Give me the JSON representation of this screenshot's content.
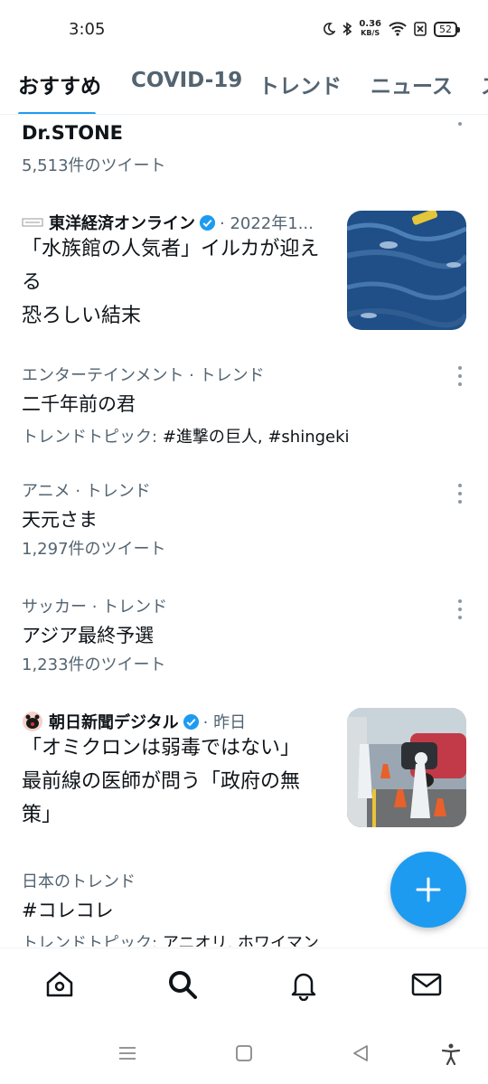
{
  "status": {
    "time": "3:05",
    "net_speed_value": "0.36",
    "net_speed_unit": "KB/S",
    "battery": "52"
  },
  "tabs": [
    {
      "label": "おすすめ"
    },
    {
      "label": "COVID-19"
    },
    {
      "label": "トレンド"
    },
    {
      "label": "ニュース"
    },
    {
      "label": "ス"
    }
  ],
  "feed": {
    "trend1": {
      "title": "Dr.STONE",
      "count": "5,513件のツイート"
    },
    "news1": {
      "source": "東洋経済オンライン",
      "meta": "· 2022年1...",
      "headline_line1": "「水族館の人気者」イルカが迎える",
      "headline_line2": "恐ろしい結末",
      "thumb_icon": "dolphins-photo"
    },
    "trend2": {
      "category": "エンターテインメント · トレンド",
      "title": "二千年前の君",
      "topic_label": "トレンドトピック:",
      "topic_value": "#進撃の巨人, #shingeki"
    },
    "trend3": {
      "category": "アニメ · トレンド",
      "title": "天元さま",
      "count": "1,297件のツイート"
    },
    "trend4": {
      "category": "サッカー · トレンド",
      "title": "アジア最終予選",
      "count": "1,233件のツイート"
    },
    "news2": {
      "source": "朝日新聞デジタル",
      "meta": "· 昨日",
      "headline_line1": "「オミクロンは弱毒ではない」",
      "headline_line2": "最前線の医師が問う「政府の無",
      "headline_line3": "策」",
      "thumb_icon": "medical-testing-photo"
    },
    "trend5": {
      "category": "日本のトレンド",
      "title": "#コレコレ",
      "topic_label": "トレンドトピック:",
      "topic_value": "アニオリ, ホワイマン"
    }
  },
  "colors": {
    "accent": "#1d9bf0",
    "text": "#0f1419",
    "secondary": "#536471"
  }
}
